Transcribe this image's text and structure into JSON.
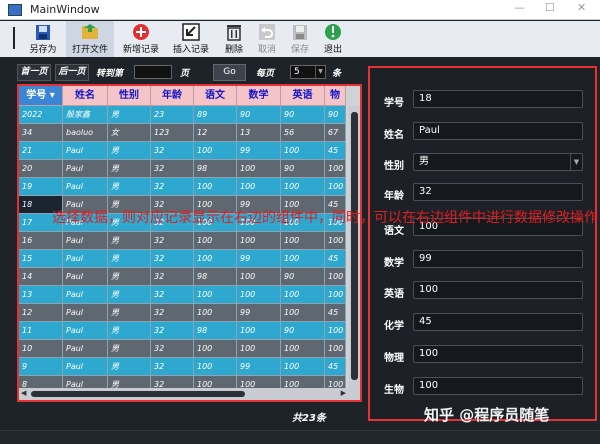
{
  "window": {
    "title": "MainWindow"
  },
  "toolbar": {
    "items": [
      {
        "label": "另存为",
        "icon": "save-as-icon",
        "color": "#2a58b8"
      },
      {
        "label": "打开文件",
        "icon": "open-file-icon",
        "color": "#e2b23a"
      },
      {
        "label": "新增记录",
        "icon": "add-record-icon",
        "color": "#e03030"
      },
      {
        "label": "插入记录",
        "icon": "insert-record-icon",
        "color": "#222222"
      },
      {
        "label": "删除",
        "icon": "delete-icon",
        "color": "#333333"
      },
      {
        "label": "取消",
        "icon": "undo-icon",
        "color": "#9a9a9a"
      },
      {
        "label": "保存",
        "icon": "save-icon",
        "color": "#9a9a9a"
      },
      {
        "label": "退出",
        "icon": "exit-icon",
        "color": "#2aa14a"
      }
    ]
  },
  "pager": {
    "first": "首一页",
    "prev": "后一页",
    "goto_label": "转到第",
    "page_unit": "页",
    "go": "Go",
    "per_page": "每页",
    "per_page_value": "5",
    "per_unit": "条",
    "total": "共23条"
  },
  "table": {
    "columns": [
      "学号",
      "姓名",
      "性别",
      "年龄",
      "语文",
      "数学",
      "英语",
      "物"
    ],
    "rows": [
      [
        "2022",
        "殷家鑫",
        "男",
        "23",
        "89",
        "90",
        "90",
        "90"
      ],
      [
        "34",
        "baoluo",
        "女",
        "123",
        "12",
        "13",
        "56",
        "67"
      ],
      [
        "21",
        "Paul",
        "男",
        "32",
        "100",
        "99",
        "100",
        "45"
      ],
      [
        "20",
        "Paul",
        "男",
        "32",
        "98",
        "100",
        "90",
        "100"
      ],
      [
        "19",
        "Paul",
        "男",
        "32",
        "100",
        "100",
        "100",
        "100"
      ],
      [
        "18",
        "Paul",
        "男",
        "32",
        "100",
        "99",
        "100",
        "45"
      ],
      [
        "17",
        "Paul",
        "男",
        "32",
        "100",
        "100",
        "100",
        "100"
      ],
      [
        "16",
        "Paul",
        "男",
        "32",
        "100",
        "100",
        "100",
        "100"
      ],
      [
        "15",
        "Paul",
        "男",
        "32",
        "100",
        "99",
        "100",
        "45"
      ],
      [
        "14",
        "Paul",
        "男",
        "32",
        "98",
        "100",
        "90",
        "100"
      ],
      [
        "13",
        "Paul",
        "男",
        "32",
        "100",
        "100",
        "100",
        "100"
      ],
      [
        "12",
        "Paul",
        "男",
        "32",
        "100",
        "99",
        "100",
        "45"
      ],
      [
        "11",
        "Paul",
        "男",
        "32",
        "98",
        "100",
        "90",
        "100"
      ],
      [
        "10",
        "Paul",
        "男",
        "32",
        "100",
        "100",
        "100",
        "100"
      ],
      [
        "9",
        "Paul",
        "男",
        "32",
        "100",
        "99",
        "100",
        "45"
      ],
      [
        "8",
        "Paul",
        "男",
        "32",
        "100",
        "100",
        "100",
        "100"
      ]
    ]
  },
  "overlay_text": "选择数据，则对应记录显示在右边的组件中，同时，可以在右边组件中进行数据修改操作",
  "form": {
    "fields": [
      {
        "label": "学号",
        "value": "18"
      },
      {
        "label": "姓名",
        "value": "Paul"
      },
      {
        "label": "性别",
        "value": "男"
      },
      {
        "label": "年龄",
        "value": "32"
      },
      {
        "label": "语文",
        "value": "100"
      },
      {
        "label": "数学",
        "value": "99"
      },
      {
        "label": "英语",
        "value": "100"
      },
      {
        "label": "化学",
        "value": "45"
      },
      {
        "label": "物理",
        "value": "100"
      },
      {
        "label": "生物",
        "value": "100"
      }
    ]
  },
  "watermark": "知乎 @程序员随笔"
}
